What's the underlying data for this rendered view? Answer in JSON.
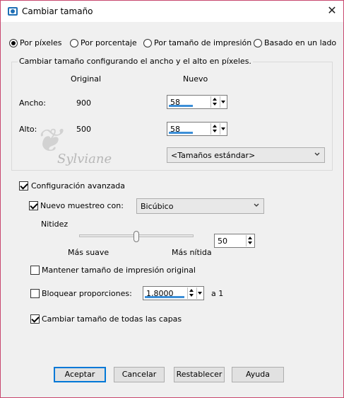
{
  "window": {
    "title": "Cambiar tamaño",
    "icons": {
      "app": "image-icon",
      "close": "close-icon"
    },
    "close_glyph": "✕"
  },
  "mode_radios": [
    {
      "label": "Por píxeles",
      "selected": true
    },
    {
      "label": "Por porcentaje",
      "selected": false
    },
    {
      "label": "Por tamaño de impresión",
      "selected": false
    },
    {
      "label": "Basado en un lado",
      "selected": false
    }
  ],
  "pixels_group": {
    "caption": "Cambiar tamaño configurando el ancho y el alto en píxeles.",
    "header_original": "Original",
    "header_new": "Nuevo",
    "width_label": "Ancho:",
    "width_original": "900",
    "width_new": "58",
    "height_label": "Alto:",
    "height_original": "500",
    "height_new": "58",
    "standard_sizes": "<Tamaños estándar>",
    "watermark": "Sylviane"
  },
  "advanced": {
    "label": "Configuración avanzada",
    "checked": true,
    "resample_label": "Nuevo muestreo con:",
    "resample_checked": true,
    "resample_method": "Bicúbico",
    "sharpness_label": "Nitidez",
    "softer_label": "Más suave",
    "sharper_label": "Más nítida",
    "sharpness_value": "50",
    "sharpness_level": 0.5,
    "keep_print_size_label": "Mantener tamaño de impresión original",
    "keep_print_size_checked": false,
    "lock_ratio_label": "Bloquear proporciones:",
    "lock_ratio_checked": false,
    "ratio_value": "1,8000",
    "ratio_suffix": "a 1",
    "all_layers_label": "Cambiar tamaño de todas las capas",
    "all_layers_checked": true
  },
  "buttons": {
    "ok": "Aceptar",
    "cancel": "Cancelar",
    "reset": "Restablecer",
    "help": "Ayuda"
  },
  "colors": {
    "accent": "#0078d7",
    "window_border": "#c8486f",
    "spin_underline": "#3c8fd8"
  }
}
